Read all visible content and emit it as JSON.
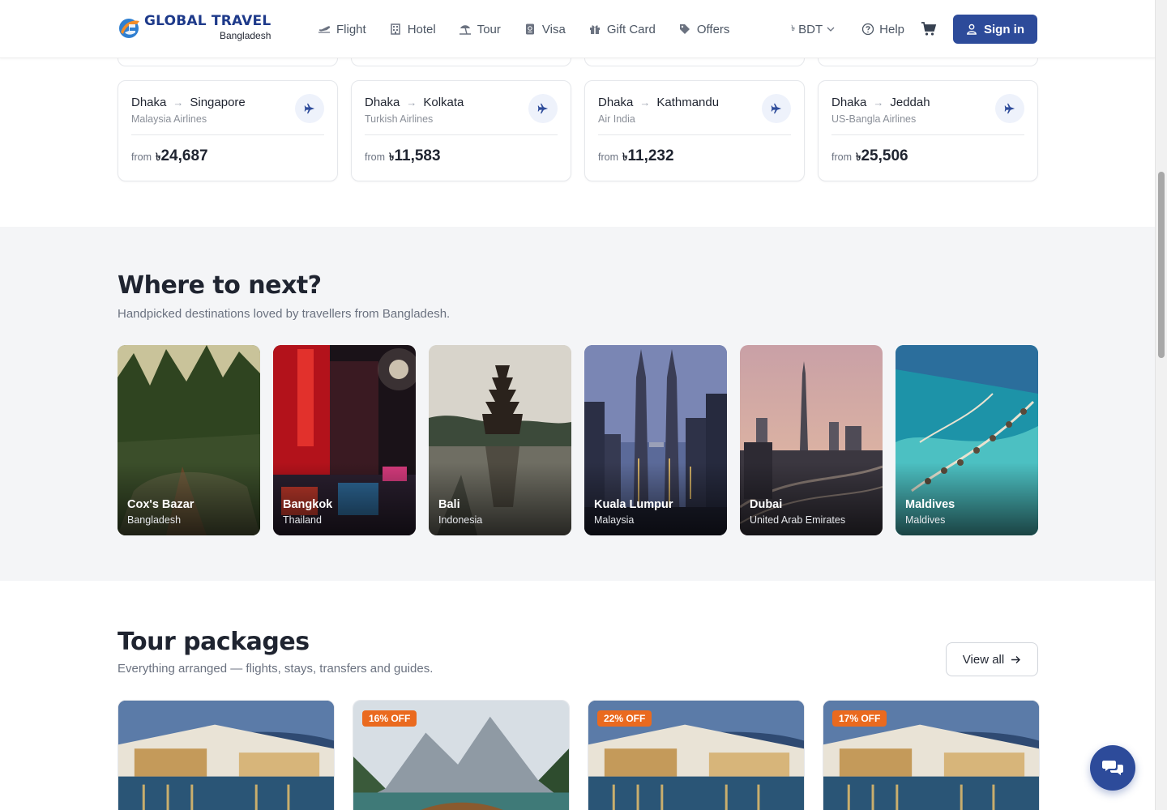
{
  "brand": {
    "title": "GLOBAL TRAVEL",
    "subtitle": "Bangladesh"
  },
  "nav": [
    {
      "label": "Flight",
      "icon": "plane-icon"
    },
    {
      "label": "Hotel",
      "icon": "building-icon"
    },
    {
      "label": "Tour",
      "icon": "beach-icon"
    },
    {
      "label": "Visa",
      "icon": "passport-icon"
    },
    {
      "label": "Gift Card",
      "icon": "gift-icon"
    },
    {
      "label": "Offers",
      "icon": "tag-icon"
    }
  ],
  "header_right": {
    "currency_symbol": "৳",
    "currency": "BDT",
    "help": "Help",
    "signin": "Sign in"
  },
  "flights": [
    {
      "from": "Dhaka",
      "to": "Singapore",
      "airline": "Malaysia Airlines",
      "from_label": "from",
      "currency": "৳",
      "price": "24,687"
    },
    {
      "from": "Dhaka",
      "to": "Kolkata",
      "airline": "Turkish Airlines",
      "from_label": "from",
      "currency": "৳",
      "price": "11,583"
    },
    {
      "from": "Dhaka",
      "to": "Kathmandu",
      "airline": "Air India",
      "from_label": "from",
      "currency": "৳",
      "price": "11,232"
    },
    {
      "from": "Dhaka",
      "to": "Jeddah",
      "airline": "US-Bangla Airlines",
      "from_label": "from",
      "currency": "৳",
      "price": "25,506"
    }
  ],
  "destinations_section": {
    "title": "Where to next?",
    "subtitle": "Handpicked destinations loved by travellers from Bangladesh.",
    "items": [
      {
        "name": "Cox's Bazar",
        "country": "Bangladesh"
      },
      {
        "name": "Bangkok",
        "country": "Thailand"
      },
      {
        "name": "Bali",
        "country": "Indonesia"
      },
      {
        "name": "Kuala Lumpur",
        "country": "Malaysia"
      },
      {
        "name": "Dubai",
        "country": "United Arab Emirates"
      },
      {
        "name": "Maldives",
        "country": "Maldives"
      }
    ]
  },
  "tours_section": {
    "title": "Tour packages",
    "subtitle": "Everything arranged — flights, stays, transfers and guides.",
    "view_all": "View all",
    "cards": [
      {
        "badge": ""
      },
      {
        "badge": "16% OFF"
      },
      {
        "badge": "22% OFF"
      },
      {
        "badge": "17% OFF"
      }
    ]
  },
  "colors": {
    "primary": "#2d4b9a",
    "badge": "#ea6a1f",
    "section_bg": "#f4f5f7"
  }
}
